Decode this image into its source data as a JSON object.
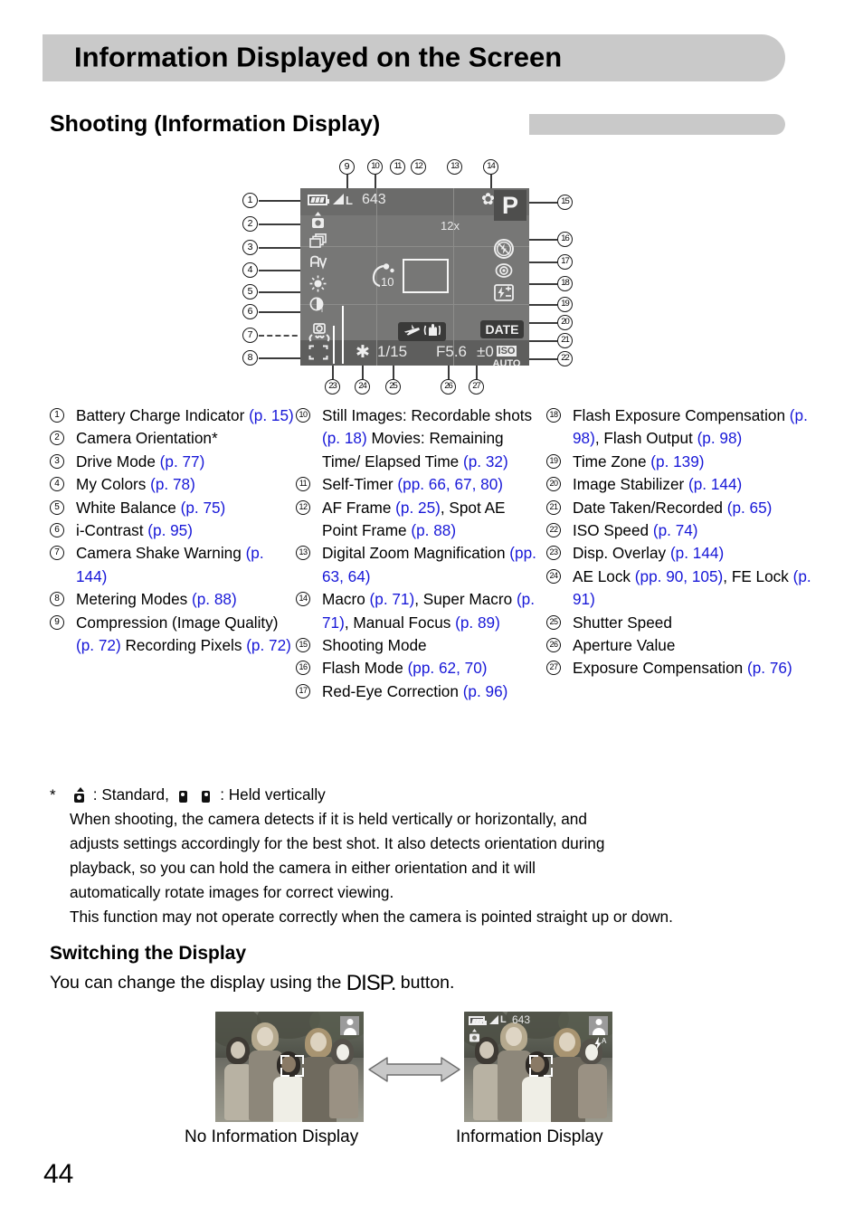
{
  "page": {
    "number": "44",
    "title": "Information Displayed on the Screen",
    "section_heading": "Shooting (Information Display)"
  },
  "lcd": {
    "recordable_shots": "643",
    "digital_zoom": "12x",
    "shooting_mode": "P",
    "self_timer": "10",
    "date_stamp": "DATE",
    "iso_label": "ISO",
    "iso_value": "AUTO",
    "quality_label": "L",
    "shutter_speed": "1/15",
    "aperture": "F5.6",
    "exposure_compensation": "±0",
    "ae_lock_icon": "asterisk-icon",
    "macro_icon": "flower-icon",
    "flash_off_icon": "flash-off-icon",
    "red_eye_icon": "red-eye-icon",
    "flash_exp_icon": "flash-exposure-icon",
    "time_zone_icon": "airplane-icon",
    "image_stabilizer_icon": "hand-shake-icon",
    "battery_icon": "battery-full-icon",
    "orientation_icon": "camera-orientation-icon",
    "drive_mode_icon": "drive-mode-icon",
    "my_colors_icon": "my-colors-icon",
    "white_balance_icon": "white-balance-sun-icon",
    "i_contrast_icon": "i-contrast-icon",
    "shake_warning_icon": "camera-shake-warning-icon",
    "metering_icon": "metering-mode-icon"
  },
  "callouts": {
    "top": [
      "9",
      "10",
      "11",
      "12",
      "13",
      "14"
    ],
    "left": [
      "1",
      "2",
      "3",
      "4",
      "5",
      "6",
      "7",
      "8"
    ],
    "right": [
      "15",
      "16",
      "17",
      "18",
      "19",
      "20",
      "21",
      "22"
    ],
    "bottom": [
      "23",
      "24",
      "25",
      "26",
      "27"
    ]
  },
  "legend": {
    "col1": [
      {
        "num": "1",
        "parts": [
          {
            "t": "Battery Charge Indicator ",
            "ref": false
          },
          {
            "t": "(p. 15)",
            "ref": true
          }
        ]
      },
      {
        "num": "2",
        "parts": [
          {
            "t": "Camera Orientation*",
            "ref": false
          }
        ]
      },
      {
        "num": "3",
        "parts": [
          {
            "t": "Drive Mode ",
            "ref": false
          },
          {
            "t": "(p. 77)",
            "ref": true
          }
        ]
      },
      {
        "num": "4",
        "parts": [
          {
            "t": "My Colors ",
            "ref": false
          },
          {
            "t": "(p. 78)",
            "ref": true
          }
        ]
      },
      {
        "num": "5",
        "parts": [
          {
            "t": "White Balance ",
            "ref": false
          },
          {
            "t": "(p. 75)",
            "ref": true
          }
        ]
      },
      {
        "num": "6",
        "parts": [
          {
            "t": "i-Contrast ",
            "ref": false
          },
          {
            "t": "(p. 95)",
            "ref": true
          }
        ]
      },
      {
        "num": "7",
        "parts": [
          {
            "t": "Camera Shake Warning ",
            "ref": false
          },
          {
            "t": "(p. 144)",
            "ref": true
          }
        ]
      },
      {
        "num": "8",
        "parts": [
          {
            "t": "Metering Modes ",
            "ref": false
          },
          {
            "t": "(p. 88)",
            "ref": true
          }
        ]
      },
      {
        "num": "9",
        "parts": [
          {
            "t": "Compression (Image Quality) ",
            "ref": false
          },
          {
            "t": "(p. 72)",
            "ref": true
          },
          {
            "t": " Recording Pixels ",
            "ref": false
          },
          {
            "t": "(p. 72)",
            "ref": true
          }
        ]
      }
    ],
    "col2": [
      {
        "num": "10",
        "parts": [
          {
            "t": "Still Images: Recordable shots ",
            "ref": false
          },
          {
            "t": "(p. 18)",
            "ref": true
          },
          {
            "t": " Movies: Remaining Time/ Elapsed Time ",
            "ref": false
          },
          {
            "t": "(p. 32)",
            "ref": true
          }
        ]
      },
      {
        "num": "11",
        "parts": [
          {
            "t": "Self-Timer ",
            "ref": false
          },
          {
            "t": "(pp. 66, 67, 80)",
            "ref": true
          }
        ]
      },
      {
        "num": "12",
        "parts": [
          {
            "t": "AF Frame ",
            "ref": false
          },
          {
            "t": "(p. 25)",
            "ref": true
          },
          {
            "t": ", Spot AE Point Frame ",
            "ref": false
          },
          {
            "t": "(p. 88)",
            "ref": true
          }
        ]
      },
      {
        "num": "13",
        "parts": [
          {
            "t": "Digital Zoom Magnification ",
            "ref": false
          },
          {
            "t": "(pp. 63, 64)",
            "ref": true
          }
        ]
      },
      {
        "num": "14",
        "parts": [
          {
            "t": "Macro ",
            "ref": false
          },
          {
            "t": "(p. 71)",
            "ref": true
          },
          {
            "t": ", Super Macro ",
            "ref": false
          },
          {
            "t": "(p. 71)",
            "ref": true
          },
          {
            "t": ", Manual Focus ",
            "ref": false
          },
          {
            "t": "(p. 89)",
            "ref": true
          }
        ]
      },
      {
        "num": "15",
        "parts": [
          {
            "t": "Shooting Mode",
            "ref": false
          }
        ]
      },
      {
        "num": "16",
        "parts": [
          {
            "t": "Flash Mode ",
            "ref": false
          },
          {
            "t": "(pp. 62, 70)",
            "ref": true
          }
        ]
      },
      {
        "num": "17",
        "parts": [
          {
            "t": "Red-Eye Correction ",
            "ref": false
          },
          {
            "t": "(p. 96)",
            "ref": true
          }
        ]
      }
    ],
    "col3": [
      {
        "num": "18",
        "parts": [
          {
            "t": "Flash Exposure Compensation ",
            "ref": false
          },
          {
            "t": "(p. 98)",
            "ref": true
          },
          {
            "t": ", Flash Output ",
            "ref": false
          },
          {
            "t": "(p. 98)",
            "ref": true
          }
        ]
      },
      {
        "num": "19",
        "parts": [
          {
            "t": "Time Zone ",
            "ref": false
          },
          {
            "t": "(p. 139)",
            "ref": true
          }
        ]
      },
      {
        "num": "20",
        "parts": [
          {
            "t": "Image Stabilizer ",
            "ref": false
          },
          {
            "t": "(p. 144)",
            "ref": true
          }
        ]
      },
      {
        "num": "21",
        "parts": [
          {
            "t": "Date Taken/Recorded ",
            "ref": false
          },
          {
            "t": "(p. 65)",
            "ref": true
          }
        ]
      },
      {
        "num": "22",
        "parts": [
          {
            "t": "ISO Speed ",
            "ref": false
          },
          {
            "t": "(p. 74)",
            "ref": true
          }
        ]
      },
      {
        "num": "23",
        "parts": [
          {
            "t": "Disp. Overlay ",
            "ref": false
          },
          {
            "t": "(p. 144)",
            "ref": true
          }
        ]
      },
      {
        "num": "24",
        "parts": [
          {
            "t": "AE Lock ",
            "ref": false
          },
          {
            "t": "(pp. 90, 105)",
            "ref": true
          },
          {
            "t": ", FE Lock ",
            "ref": false
          },
          {
            "t": "(p. 91)",
            "ref": true
          }
        ]
      },
      {
        "num": "25",
        "parts": [
          {
            "t": "Shutter Speed",
            "ref": false
          }
        ]
      },
      {
        "num": "26",
        "parts": [
          {
            "t": "Aperture Value",
            "ref": false
          }
        ]
      },
      {
        "num": "27",
        "parts": [
          {
            "t": "Exposure Compensation ",
            "ref": false
          },
          {
            "t": "(p. 76)",
            "ref": true
          }
        ]
      }
    ]
  },
  "footnote": {
    "marker": "*",
    "legend_standard": ": Standard,",
    "legend_vertical": ": Held vertically",
    "line1": "When shooting, the camera detects if it is held vertically or horizontally, and",
    "line2": "adjusts settings accordingly for the best shot. It also detects orientation during",
    "line3": "playback, so you can hold the camera in either orientation and it will",
    "line4": "automatically rotate images for correct viewing.",
    "line5": "This function may not operate correctly when the camera is pointed straight up or down."
  },
  "switching": {
    "heading": "Switching the Display",
    "text_before": "You can change the display using the ",
    "disp_button": "DISP.",
    "text_after": " button."
  },
  "thumbnails": {
    "left_caption": "No Information Display",
    "right_caption": "Information Display",
    "overlay": {
      "quality": "L",
      "shots": "643",
      "flash_auto": "A"
    }
  },
  "colors": {
    "banner": "#c9c9c9",
    "reference_link": "#1818d8",
    "lcd_background": "#777776"
  }
}
